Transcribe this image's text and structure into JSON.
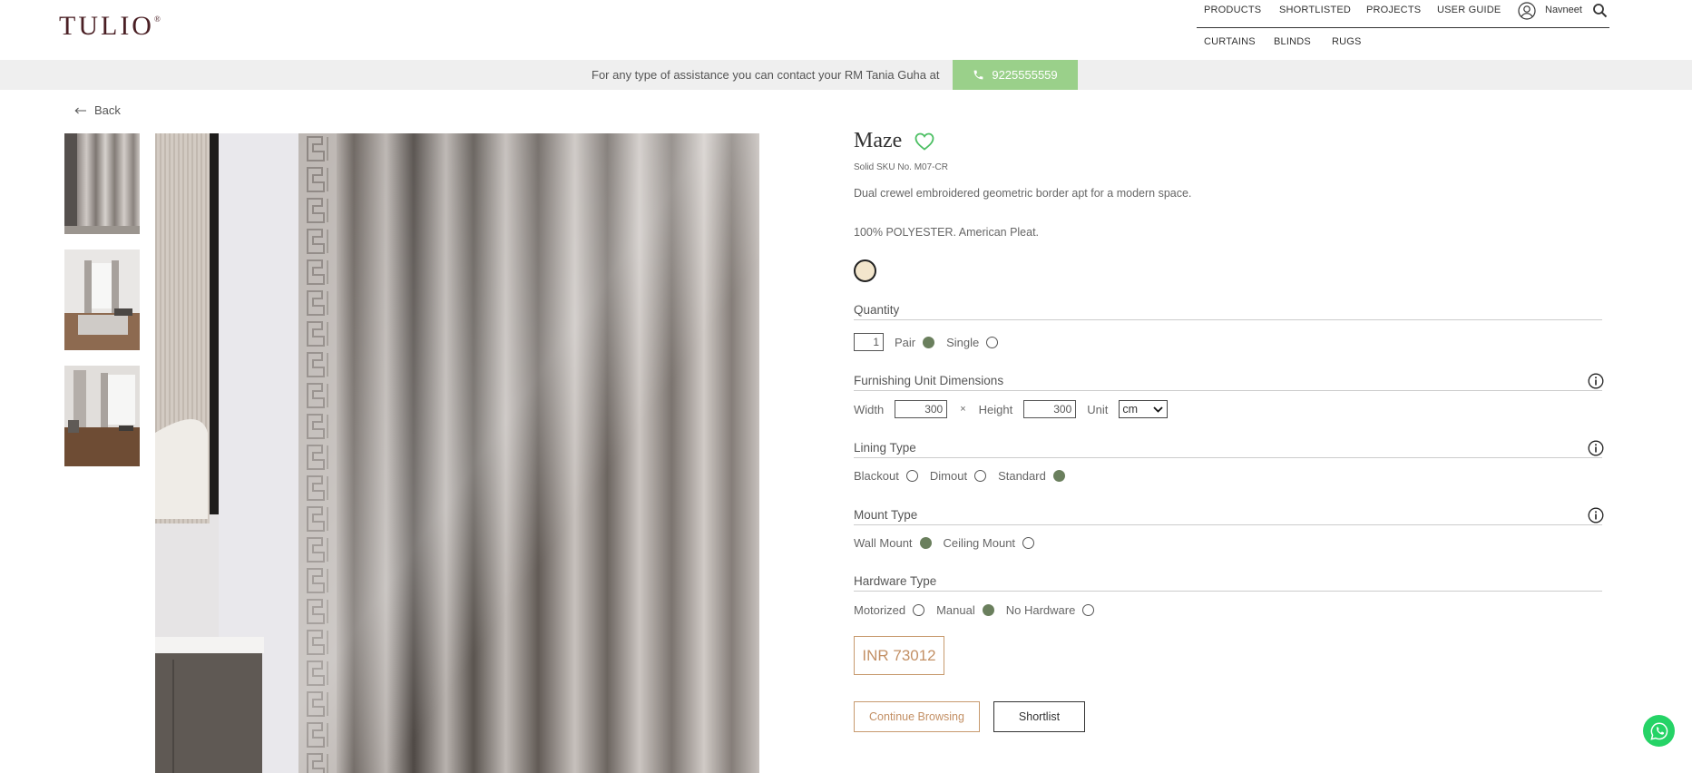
{
  "brand": {
    "logo_text": "TULIO",
    "logo_mark": "®"
  },
  "nav": {
    "top": [
      "PRODUCTS",
      "SHORTLISTED",
      "PROJECTS",
      "USER GUIDE"
    ],
    "user_name": "Navneet",
    "sub": [
      "CURTAINS",
      "BLINDS",
      "RUGS"
    ]
  },
  "assist": {
    "text": "For any type of assistance you can contact your RM Tania Guha at",
    "phone": "9225555559",
    "phone_bg": "#9ad08a"
  },
  "back_label": "Back",
  "product": {
    "name": "Maze",
    "sku": "Solid SKU No. M07-CR",
    "description": "Dual crewel embroidered geometric border apt for a modern space.",
    "material": "100% POLYESTER. American Pleat.",
    "swatch_color": "#f3e6cc"
  },
  "quantity": {
    "title": "Quantity",
    "value": "1",
    "options": [
      "Pair",
      "Single"
    ],
    "selected": "Pair"
  },
  "dimensions": {
    "title": "Furnishing Unit Dimensions",
    "width_label": "Width",
    "width_value": "300",
    "times": "×",
    "height_label": "Height",
    "height_value": "300",
    "unit_label": "Unit",
    "unit_value": "cm"
  },
  "lining": {
    "title": "Lining Type",
    "options": [
      "Blackout",
      "Dimout",
      "Standard"
    ],
    "selected": "Standard"
  },
  "mount": {
    "title": "Mount Type",
    "options": [
      "Wall Mount",
      "Ceiling Mount"
    ],
    "selected": "Wall Mount"
  },
  "hardware": {
    "title": "Hardware Type",
    "options": [
      "Motorized",
      "Manual",
      "No Hardware"
    ],
    "selected": "Manual"
  },
  "price": "INR 73012",
  "buttons": {
    "continue": "Continue Browsing",
    "shortlist": "Shortlist"
  },
  "colors": {
    "accent": "#c39065",
    "radio_selected": "#6a7f5d",
    "logo": "#4a1f24"
  }
}
